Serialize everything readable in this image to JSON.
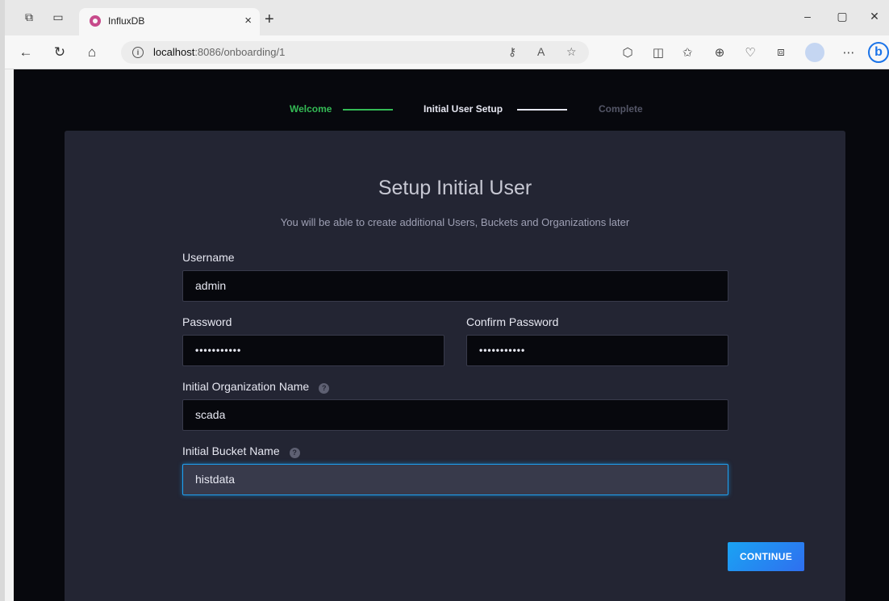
{
  "browser": {
    "tab_title": "InfluxDB",
    "tab_close": "×",
    "new_tab": "+",
    "url_host": "localhost",
    "url_rest": ":8086/onboarding/1",
    "minimize": "–",
    "maximize": "▢",
    "close": "✕"
  },
  "stepper": {
    "steps": [
      {
        "label": "Welcome",
        "state": "done"
      },
      {
        "label": "Initial User Setup",
        "state": "active"
      },
      {
        "label": "Complete",
        "state": "pending"
      }
    ],
    "colors": {
      "done": "#34bb55",
      "active": "#e7e8f2",
      "pending": "#545667"
    }
  },
  "form": {
    "title": "Setup Initial User",
    "subtitle": "You will be able to create additional Users, Buckets and Organizations later",
    "username_label": "Username",
    "username_value": "admin",
    "password_label": "Password",
    "password_value": "•••••••••••",
    "confirm_label": "Confirm Password",
    "confirm_value": "•••••••••••",
    "org_label": "Initial Organization Name",
    "org_value": "scada",
    "bucket_label": "Initial Bucket Name",
    "bucket_value": "histdata",
    "help_glyph": "?",
    "continue_label": "CONTINUE"
  },
  "icons": {
    "workspaces": "workspaces-icon",
    "tab_actions": "tab-actions-icon",
    "back": "back-arrow-icon",
    "refresh": "refresh-icon",
    "home": "home-icon",
    "info": "info-icon",
    "read_aloud": "read-aloud-icon",
    "favorite": "star-icon",
    "help": "question-icon"
  },
  "colors": {
    "accent": "#1da1f2",
    "panel": "#232533",
    "page_bg": "#07080d"
  }
}
